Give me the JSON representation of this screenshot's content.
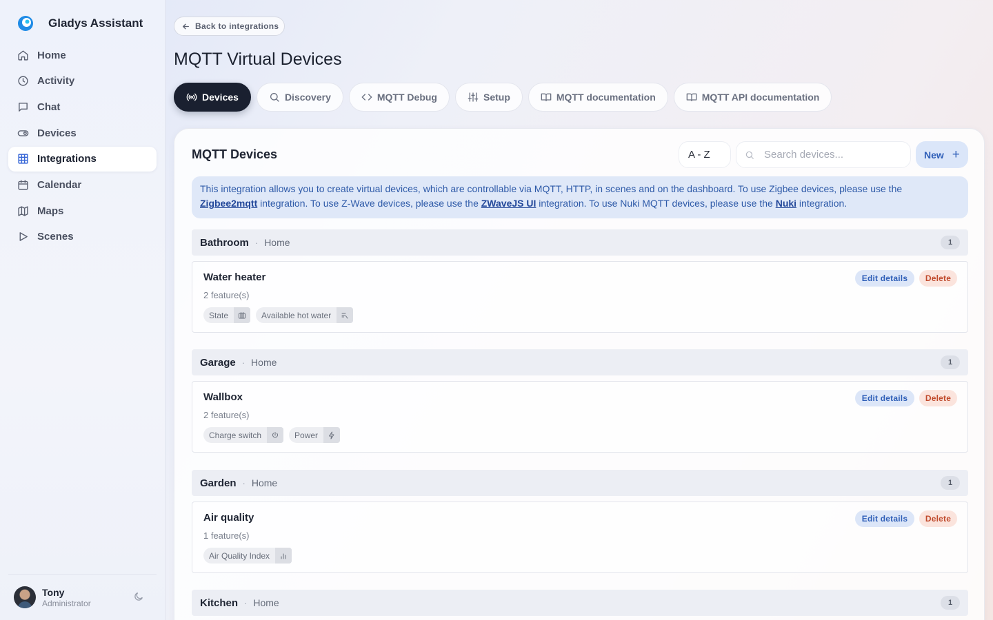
{
  "app": {
    "name": "Gladys Assistant",
    "colors": {
      "accent": "#3766d6",
      "dark": "#1a2030",
      "danger": "#c04a2c"
    }
  },
  "sidebar": {
    "items": [
      {
        "label": "Home",
        "icon": "home-icon"
      },
      {
        "label": "Activity",
        "icon": "clock-icon"
      },
      {
        "label": "Chat",
        "icon": "chat-icon"
      },
      {
        "label": "Devices",
        "icon": "toggle-icon"
      },
      {
        "label": "Integrations",
        "icon": "grid-icon",
        "active": true
      },
      {
        "label": "Calendar",
        "icon": "calendar-icon"
      },
      {
        "label": "Maps",
        "icon": "map-icon"
      },
      {
        "label": "Scenes",
        "icon": "play-icon"
      }
    ],
    "user": {
      "name": "Tony",
      "role": "Administrator"
    }
  },
  "header": {
    "back_label": "Back to integrations",
    "title": "MQTT Virtual Devices"
  },
  "tabs": [
    {
      "label": "Devices",
      "icon": "broadcast-icon",
      "active": true
    },
    {
      "label": "Discovery",
      "icon": "search-icon"
    },
    {
      "label": "MQTT Debug",
      "icon": "code-icon"
    },
    {
      "label": "Setup",
      "icon": "sliders-icon"
    },
    {
      "label": "MQTT documentation",
      "icon": "book-icon"
    },
    {
      "label": "MQTT API documentation",
      "icon": "book-icon"
    }
  ],
  "panel": {
    "title": "MQTT Devices",
    "sort_value": "A - Z",
    "search_placeholder": "Search devices...",
    "new_label": "New",
    "info": {
      "part1": "This integration allows you to create virtual devices, which are controllable via MQTT, HTTP, in scenes and on the dashboard. To use Zigbee devices, please use the ",
      "link1": "Zigbee2mqtt",
      "part2": " integration. To use Z-Wave devices, please use the ",
      "link2": "ZWaveJS UI",
      "part3": " integration. To use Nuki MQTT devices, please use the ",
      "link3": "Nuki",
      "part4": " integration."
    },
    "edit_label": "Edit details",
    "delete_label": "Delete"
  },
  "rooms": [
    {
      "name": "Bathroom",
      "house": "Home",
      "count": "1",
      "devices": [
        {
          "name": "Water heater",
          "features": "2 feature(s)",
          "chips": [
            {
              "label": "State",
              "icon": "heater-icon"
            },
            {
              "label": "Available hot water",
              "icon": "water-level-icon"
            }
          ]
        }
      ]
    },
    {
      "name": "Garage",
      "house": "Home",
      "count": "1",
      "devices": [
        {
          "name": "Wallbox",
          "features": "2 feature(s)",
          "chips": [
            {
              "label": "Charge switch",
              "icon": "power-icon"
            },
            {
              "label": "Power",
              "icon": "bolt-icon"
            }
          ]
        }
      ]
    },
    {
      "name": "Garden",
      "house": "Home",
      "count": "1",
      "devices": [
        {
          "name": "Air quality",
          "features": "1 feature(s)",
          "chips": [
            {
              "label": "Air Quality Index",
              "icon": "bar-chart-icon"
            }
          ]
        }
      ]
    },
    {
      "name": "Kitchen",
      "house": "Home",
      "count": "1",
      "devices": []
    }
  ]
}
